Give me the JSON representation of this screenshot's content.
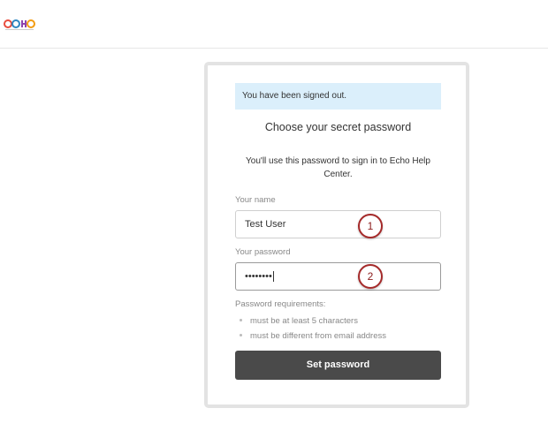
{
  "header": {
    "logo_text": "echo"
  },
  "card": {
    "notice": "You have been signed out.",
    "title": "Choose your secret password",
    "subtitle": "You'll use this password to sign in to Echo Help Center.",
    "name_label": "Your name",
    "name_value": "Test User",
    "password_label": "Your password",
    "password_value": "••••••••",
    "requirements_title": "Password requirements:",
    "requirements": [
      "must be at least 5 characters",
      "must be different from email address"
    ],
    "submit_label": "Set password"
  },
  "markers": [
    "1",
    "2"
  ],
  "colors": {
    "notice_bg": "#dbeffb",
    "button_bg": "#4a4a4a",
    "marker_border": "#a52a2a"
  }
}
